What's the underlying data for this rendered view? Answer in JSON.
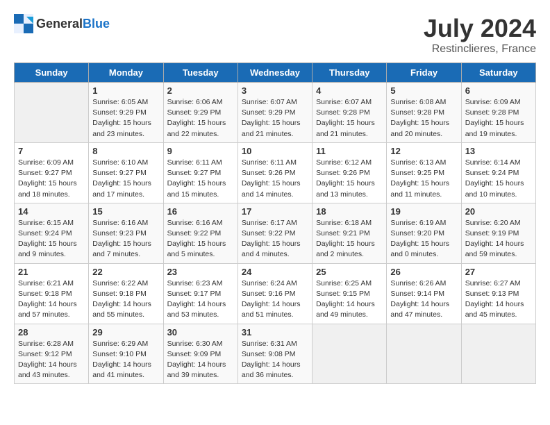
{
  "header": {
    "logo_general": "General",
    "logo_blue": "Blue",
    "month_year": "July 2024",
    "location": "Restinclieres, France"
  },
  "days_of_week": [
    "Sunday",
    "Monday",
    "Tuesday",
    "Wednesday",
    "Thursday",
    "Friday",
    "Saturday"
  ],
  "weeks": [
    [
      {
        "day": "",
        "sunrise": "",
        "sunset": "",
        "daylight": ""
      },
      {
        "day": "1",
        "sunrise": "Sunrise: 6:05 AM",
        "sunset": "Sunset: 9:29 PM",
        "daylight": "Daylight: 15 hours and 23 minutes."
      },
      {
        "day": "2",
        "sunrise": "Sunrise: 6:06 AM",
        "sunset": "Sunset: 9:29 PM",
        "daylight": "Daylight: 15 hours and 22 minutes."
      },
      {
        "day": "3",
        "sunrise": "Sunrise: 6:07 AM",
        "sunset": "Sunset: 9:29 PM",
        "daylight": "Daylight: 15 hours and 21 minutes."
      },
      {
        "day": "4",
        "sunrise": "Sunrise: 6:07 AM",
        "sunset": "Sunset: 9:28 PM",
        "daylight": "Daylight: 15 hours and 21 minutes."
      },
      {
        "day": "5",
        "sunrise": "Sunrise: 6:08 AM",
        "sunset": "Sunset: 9:28 PM",
        "daylight": "Daylight: 15 hours and 20 minutes."
      },
      {
        "day": "6",
        "sunrise": "Sunrise: 6:09 AM",
        "sunset": "Sunset: 9:28 PM",
        "daylight": "Daylight: 15 hours and 19 minutes."
      }
    ],
    [
      {
        "day": "7",
        "sunrise": "Sunrise: 6:09 AM",
        "sunset": "Sunset: 9:27 PM",
        "daylight": "Daylight: 15 hours and 18 minutes."
      },
      {
        "day": "8",
        "sunrise": "Sunrise: 6:10 AM",
        "sunset": "Sunset: 9:27 PM",
        "daylight": "Daylight: 15 hours and 17 minutes."
      },
      {
        "day": "9",
        "sunrise": "Sunrise: 6:11 AM",
        "sunset": "Sunset: 9:27 PM",
        "daylight": "Daylight: 15 hours and 15 minutes."
      },
      {
        "day": "10",
        "sunrise": "Sunrise: 6:11 AM",
        "sunset": "Sunset: 9:26 PM",
        "daylight": "Daylight: 15 hours and 14 minutes."
      },
      {
        "day": "11",
        "sunrise": "Sunrise: 6:12 AM",
        "sunset": "Sunset: 9:26 PM",
        "daylight": "Daylight: 15 hours and 13 minutes."
      },
      {
        "day": "12",
        "sunrise": "Sunrise: 6:13 AM",
        "sunset": "Sunset: 9:25 PM",
        "daylight": "Daylight: 15 hours and 11 minutes."
      },
      {
        "day": "13",
        "sunrise": "Sunrise: 6:14 AM",
        "sunset": "Sunset: 9:24 PM",
        "daylight": "Daylight: 15 hours and 10 minutes."
      }
    ],
    [
      {
        "day": "14",
        "sunrise": "Sunrise: 6:15 AM",
        "sunset": "Sunset: 9:24 PM",
        "daylight": "Daylight: 15 hours and 9 minutes."
      },
      {
        "day": "15",
        "sunrise": "Sunrise: 6:16 AM",
        "sunset": "Sunset: 9:23 PM",
        "daylight": "Daylight: 15 hours and 7 minutes."
      },
      {
        "day": "16",
        "sunrise": "Sunrise: 6:16 AM",
        "sunset": "Sunset: 9:22 PM",
        "daylight": "Daylight: 15 hours and 5 minutes."
      },
      {
        "day": "17",
        "sunrise": "Sunrise: 6:17 AM",
        "sunset": "Sunset: 9:22 PM",
        "daylight": "Daylight: 15 hours and 4 minutes."
      },
      {
        "day": "18",
        "sunrise": "Sunrise: 6:18 AM",
        "sunset": "Sunset: 9:21 PM",
        "daylight": "Daylight: 15 hours and 2 minutes."
      },
      {
        "day": "19",
        "sunrise": "Sunrise: 6:19 AM",
        "sunset": "Sunset: 9:20 PM",
        "daylight": "Daylight: 15 hours and 0 minutes."
      },
      {
        "day": "20",
        "sunrise": "Sunrise: 6:20 AM",
        "sunset": "Sunset: 9:19 PM",
        "daylight": "Daylight: 14 hours and 59 minutes."
      }
    ],
    [
      {
        "day": "21",
        "sunrise": "Sunrise: 6:21 AM",
        "sunset": "Sunset: 9:18 PM",
        "daylight": "Daylight: 14 hours and 57 minutes."
      },
      {
        "day": "22",
        "sunrise": "Sunrise: 6:22 AM",
        "sunset": "Sunset: 9:18 PM",
        "daylight": "Daylight: 14 hours and 55 minutes."
      },
      {
        "day": "23",
        "sunrise": "Sunrise: 6:23 AM",
        "sunset": "Sunset: 9:17 PM",
        "daylight": "Daylight: 14 hours and 53 minutes."
      },
      {
        "day": "24",
        "sunrise": "Sunrise: 6:24 AM",
        "sunset": "Sunset: 9:16 PM",
        "daylight": "Daylight: 14 hours and 51 minutes."
      },
      {
        "day": "25",
        "sunrise": "Sunrise: 6:25 AM",
        "sunset": "Sunset: 9:15 PM",
        "daylight": "Daylight: 14 hours and 49 minutes."
      },
      {
        "day": "26",
        "sunrise": "Sunrise: 6:26 AM",
        "sunset": "Sunset: 9:14 PM",
        "daylight": "Daylight: 14 hours and 47 minutes."
      },
      {
        "day": "27",
        "sunrise": "Sunrise: 6:27 AM",
        "sunset": "Sunset: 9:13 PM",
        "daylight": "Daylight: 14 hours and 45 minutes."
      }
    ],
    [
      {
        "day": "28",
        "sunrise": "Sunrise: 6:28 AM",
        "sunset": "Sunset: 9:12 PM",
        "daylight": "Daylight: 14 hours and 43 minutes."
      },
      {
        "day": "29",
        "sunrise": "Sunrise: 6:29 AM",
        "sunset": "Sunset: 9:10 PM",
        "daylight": "Daylight: 14 hours and 41 minutes."
      },
      {
        "day": "30",
        "sunrise": "Sunrise: 6:30 AM",
        "sunset": "Sunset: 9:09 PM",
        "daylight": "Daylight: 14 hours and 39 minutes."
      },
      {
        "day": "31",
        "sunrise": "Sunrise: 6:31 AM",
        "sunset": "Sunset: 9:08 PM",
        "daylight": "Daylight: 14 hours and 36 minutes."
      },
      {
        "day": "",
        "sunrise": "",
        "sunset": "",
        "daylight": ""
      },
      {
        "day": "",
        "sunrise": "",
        "sunset": "",
        "daylight": ""
      },
      {
        "day": "",
        "sunrise": "",
        "sunset": "",
        "daylight": ""
      }
    ]
  ]
}
